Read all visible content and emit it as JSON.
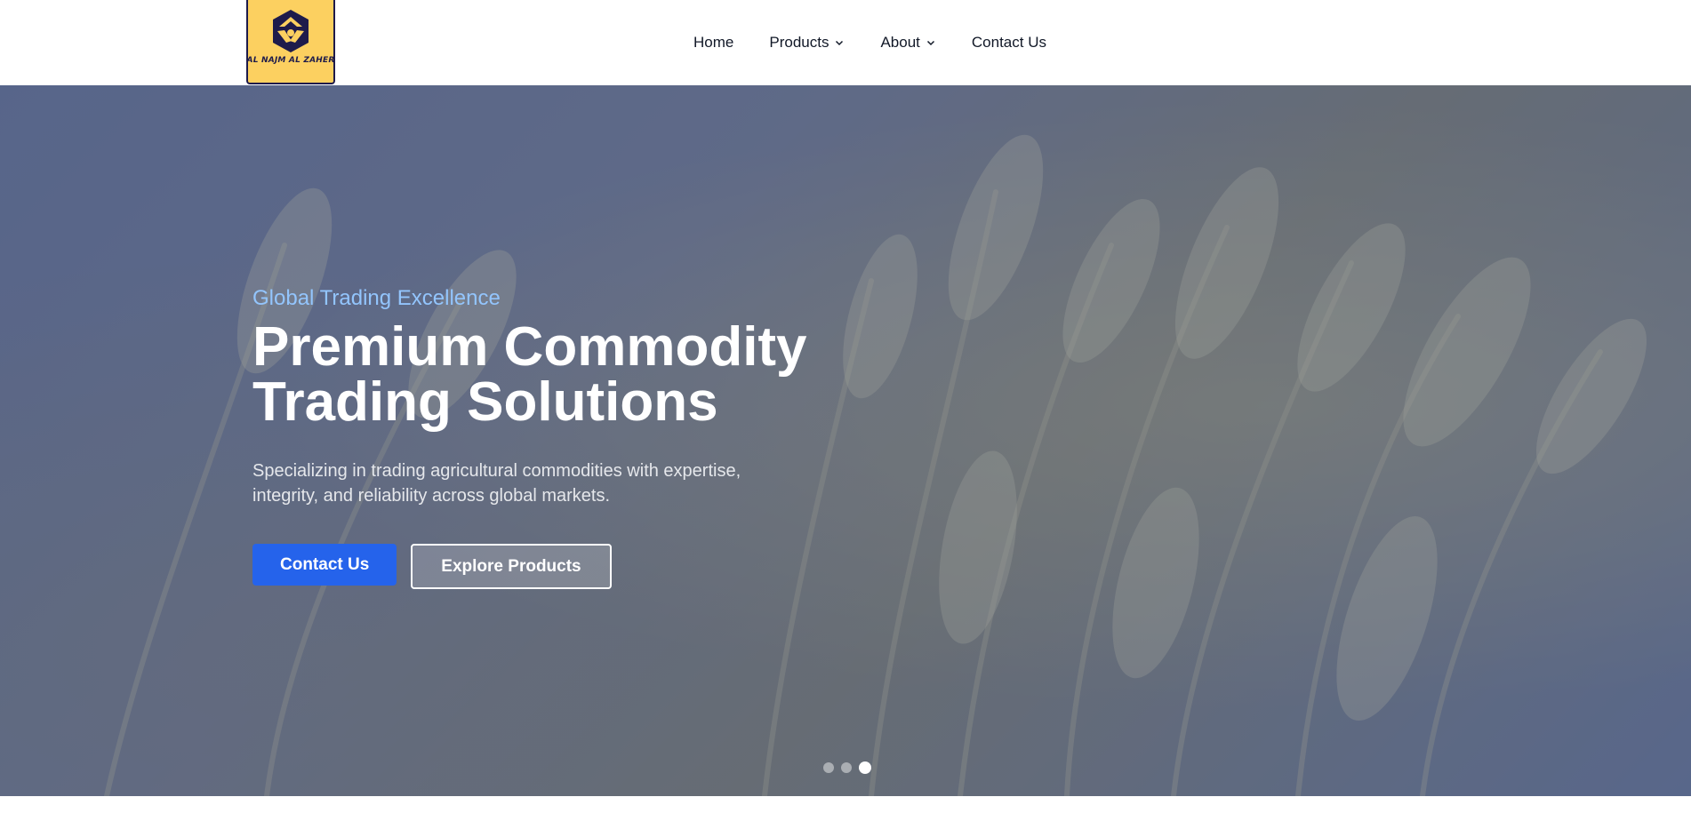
{
  "brand": {
    "logo_text": "AL NAJM AL ZAHER",
    "logo_bg": "#fcd060",
    "logo_fg": "#1e1b4b"
  },
  "nav": {
    "items": [
      {
        "label": "Home",
        "has_dropdown": false
      },
      {
        "label": "Products",
        "has_dropdown": true
      },
      {
        "label": "About",
        "has_dropdown": true
      },
      {
        "label": "Contact Us",
        "has_dropdown": false
      }
    ]
  },
  "hero": {
    "eyebrow": "Global Trading Excellence",
    "headline_line1": "Premium Commodity",
    "headline_line2": "Trading Solutions",
    "subtext": "Specializing in trading agricultural commodities with expertise, integrity, and reliability across global markets.",
    "primary_cta": "Contact Us",
    "secondary_cta": "Explore Products",
    "slides_count": 3,
    "active_slide": 3,
    "accent_color": "#2563eb",
    "eyebrow_color": "#93c5fd"
  }
}
